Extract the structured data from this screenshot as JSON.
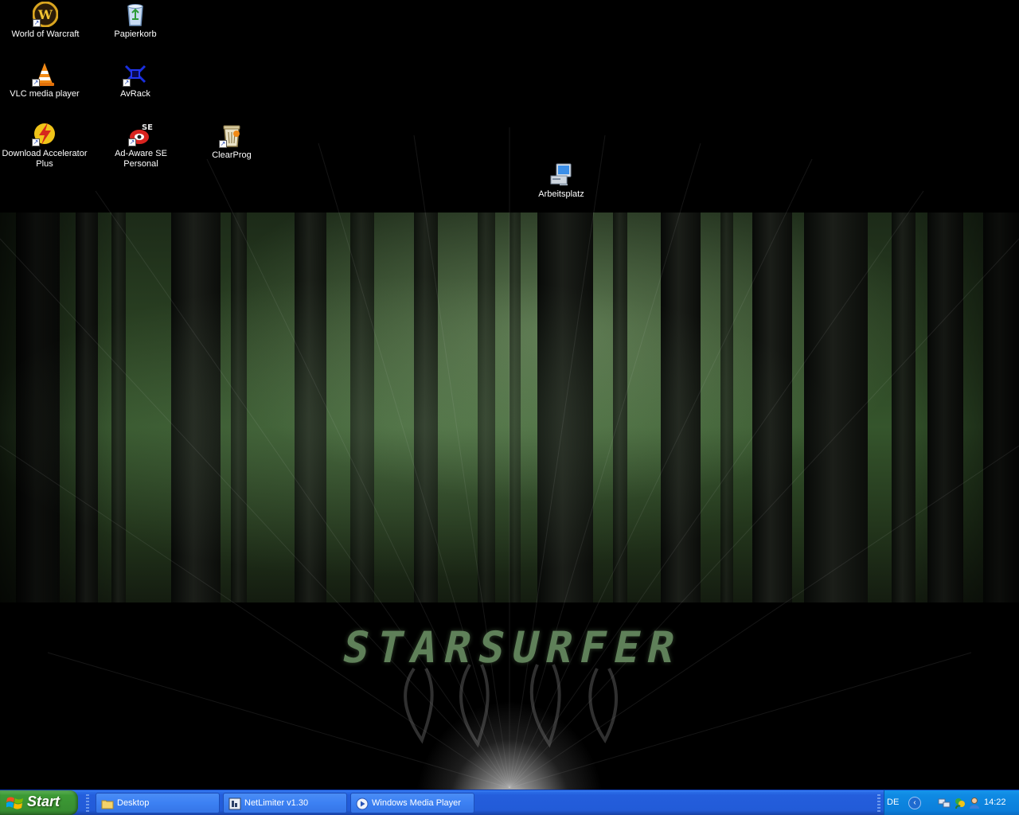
{
  "desktop": {
    "icons": [
      {
        "label": "World of Warcraft",
        "icon": "world-of-warcraft-icon",
        "shortcut": true
      },
      {
        "label": "Papierkorb",
        "icon": "recycle-bin-icon",
        "shortcut": false
      },
      {
        "label": "VLC media player",
        "icon": "vlc-cone-icon",
        "shortcut": true
      },
      {
        "label": "AvRack",
        "icon": "avrack-icon",
        "shortcut": true
      },
      {
        "label": "Download Accelerator Plus",
        "icon": "download-accelerator-icon",
        "shortcut": true
      },
      {
        "label": "Ad-Aware SE Personal",
        "icon": "ad-aware-icon",
        "shortcut": true
      },
      {
        "label": "ClearProg",
        "icon": "clearprog-icon",
        "shortcut": true
      },
      {
        "label": "Arbeitsplatz",
        "icon": "my-computer-icon",
        "shortcut": false
      }
    ],
    "wallpaper": {
      "title": "STARSURFER",
      "colors": {
        "title": "#5f8059",
        "forest": "#2c4424"
      }
    }
  },
  "taskbar": {
    "start_label": "Start",
    "tasks": [
      {
        "label": "Desktop",
        "icon": "folder-icon"
      },
      {
        "label": "NetLimiter v1.30",
        "icon": "netlimiter-icon"
      },
      {
        "label": "Windows Media Player",
        "icon": "media-player-icon"
      }
    ],
    "tray": {
      "language": "DE",
      "icons": [
        "network-icon",
        "messenger-icon",
        "user-icon"
      ],
      "clock": "14:22"
    },
    "colors": {
      "bar": "#245edc",
      "start": "#3c9a35",
      "tray": "#0f8ae3"
    }
  }
}
